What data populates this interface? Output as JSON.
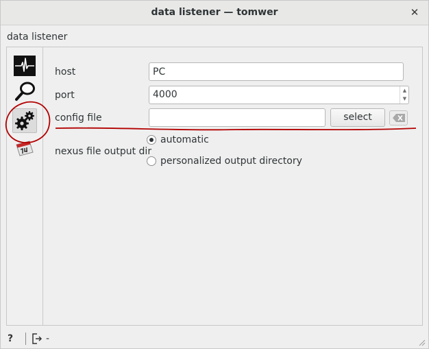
{
  "window": {
    "title": "data listener — tomwer",
    "close_glyph": "✕"
  },
  "panel": {
    "label": "data listener"
  },
  "sidebar": {
    "tools": [
      {
        "icon": "signal-icon"
      },
      {
        "icon": "magnifier-icon"
      },
      {
        "icon": "gears-icon",
        "selected": true
      },
      {
        "icon": "calendar-icon"
      }
    ]
  },
  "form": {
    "host": {
      "label": "host",
      "value": "PC"
    },
    "port": {
      "label": "port",
      "value": "4000"
    },
    "config_file": {
      "label": "config file",
      "value": "",
      "select_label": "select"
    },
    "nexus_output": {
      "label": "nexus file output dir",
      "options": [
        {
          "label": "automatic",
          "checked": true
        },
        {
          "label": "personalized output directory",
          "checked": false
        }
      ]
    }
  },
  "statusbar": {
    "help_glyph": "?",
    "status_text": "-"
  },
  "colors": {
    "annotation": "#b30000",
    "selected_tool_bg": "#dcdcdc"
  }
}
